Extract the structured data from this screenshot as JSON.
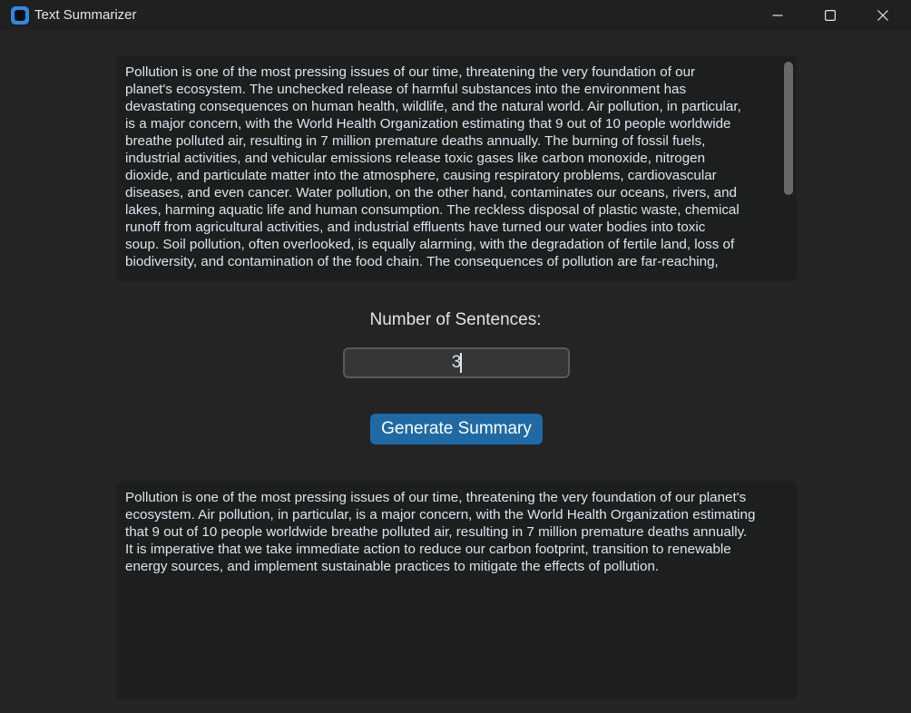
{
  "window": {
    "title": "Text Summarizer"
  },
  "input": {
    "text": "Pollution is one of the most pressing issues of our time, threatening the very foundation of our\nplanet's ecosystem. The unchecked release of harmful substances into the environment has\ndevastating consequences on human health, wildlife, and the natural world. Air pollution, in particular,\nis a major concern, with the World Health Organization estimating that 9 out of 10 people worldwide\nbreathe polluted air, resulting in 7 million premature deaths annually. The burning of fossil fuels,\nindustrial activities, and vehicular emissions release toxic gases like carbon monoxide, nitrogen\ndioxide, and particulate matter into the atmosphere, causing respiratory problems, cardiovascular\ndiseases, and even cancer. Water pollution, on the other hand, contaminates our oceans, rivers, and\nlakes, harming aquatic life and human consumption. The reckless disposal of plastic waste, chemical\nrunoff from agricultural activities, and industrial effluents have turned our water bodies into toxic\nsoup. Soil pollution, often overlooked, is equally alarming, with the degradation of fertile land, loss of\nbiodiversity, and contamination of the food chain. The consequences of pollution are far-reaching,"
  },
  "controls": {
    "sentences_label": "Number of Sentences:",
    "sentences_value": "3",
    "generate_label": "Generate Summary"
  },
  "output": {
    "text": "Pollution is one of the most pressing issues of our time, threatening the very foundation of our planet's\necosystem. Air pollution, in particular, is a major concern, with the World Health Organization estimating\nthat 9 out of 10 people worldwide breathe polluted air, resulting in 7 million premature deaths annually.\nIt is imperative that we take immediate action to reduce our carbon footprint, transition to renewable\nenergy sources, and implement sustainable practices to mitigate the effects of pollution."
  },
  "colors": {
    "accent": "#1f6aa5",
    "window_bg": "#242424",
    "textbox_bg": "#1d1e1e",
    "text": "#dce4ee"
  },
  "icons": {
    "app": "app-icon",
    "minimize": "minimize-icon",
    "maximize": "maximize-icon",
    "close": "close-icon"
  }
}
